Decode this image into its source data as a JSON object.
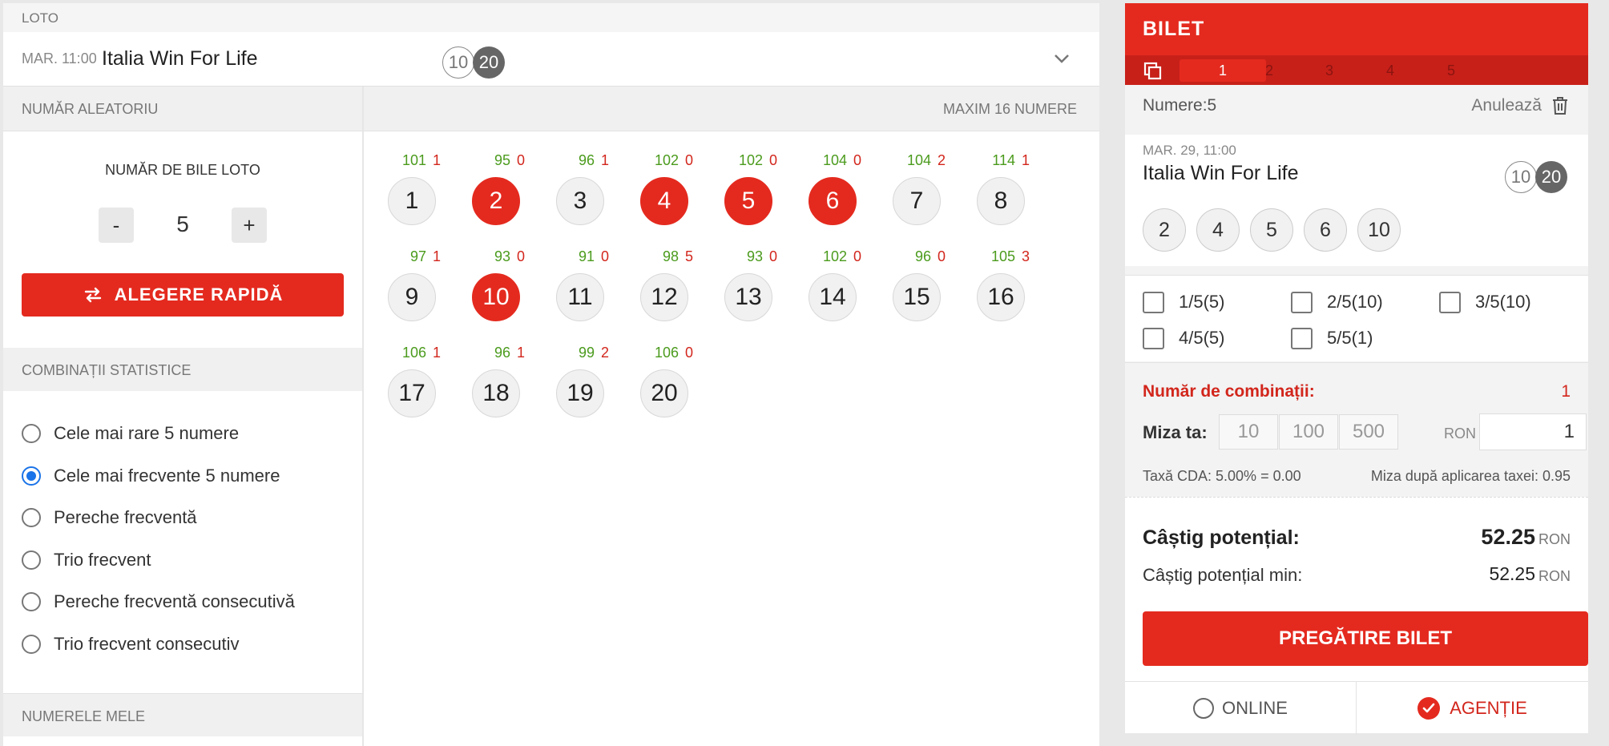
{
  "header": {
    "section_label": "LOTO",
    "event_time": "MAR. 11:00",
    "event_name": "Italia Win For Life",
    "badge_a": "10",
    "badge_b": "20"
  },
  "subbar": {
    "left": "NUMĂR ALEATORIU",
    "right": "MAXIM 16 NUMERE"
  },
  "random": {
    "title": "NUMĂR DE BILE LOTO",
    "minus": "-",
    "plus": "+",
    "value": "5",
    "quick_pick": "ALEGERE RAPIDĂ"
  },
  "combinations": {
    "header": "COMBINAȚII STATISTICE",
    "options": [
      {
        "label": "Cele mai rare 5 numere",
        "checked": false
      },
      {
        "label": "Cele mai frecvente 5 numere",
        "checked": true
      },
      {
        "label": "Pereche frecventă",
        "checked": false
      },
      {
        "label": "Trio frecvent",
        "checked": false
      },
      {
        "label": "Pereche frecventă consecutivă",
        "checked": false
      },
      {
        "label": "Trio frecvent consecutiv",
        "checked": false
      }
    ]
  },
  "my_numbers_header": "NUMERELE MELE",
  "balls": [
    {
      "n": "1",
      "freq": "101",
      "late": "1",
      "selected": false
    },
    {
      "n": "2",
      "freq": "95",
      "late": "0",
      "selected": true
    },
    {
      "n": "3",
      "freq": "96",
      "late": "1",
      "selected": false
    },
    {
      "n": "4",
      "freq": "102",
      "late": "0",
      "selected": true
    },
    {
      "n": "5",
      "freq": "102",
      "late": "0",
      "selected": true
    },
    {
      "n": "6",
      "freq": "104",
      "late": "0",
      "selected": true
    },
    {
      "n": "7",
      "freq": "104",
      "late": "2",
      "selected": false
    },
    {
      "n": "8",
      "freq": "114",
      "late": "1",
      "selected": false
    },
    {
      "n": "9",
      "freq": "97",
      "late": "1",
      "selected": false
    },
    {
      "n": "10",
      "freq": "93",
      "late": "0",
      "selected": true
    },
    {
      "n": "11",
      "freq": "91",
      "late": "0",
      "selected": false
    },
    {
      "n": "12",
      "freq": "98",
      "late": "5",
      "selected": false
    },
    {
      "n": "13",
      "freq": "93",
      "late": "0",
      "selected": false
    },
    {
      "n": "14",
      "freq": "102",
      "late": "0",
      "selected": false
    },
    {
      "n": "15",
      "freq": "96",
      "late": "0",
      "selected": false
    },
    {
      "n": "16",
      "freq": "105",
      "late": "3",
      "selected": false
    },
    {
      "n": "17",
      "freq": "106",
      "late": "1",
      "selected": false
    },
    {
      "n": "18",
      "freq": "96",
      "late": "1",
      "selected": false
    },
    {
      "n": "19",
      "freq": "99",
      "late": "2",
      "selected": false
    },
    {
      "n": "20",
      "freq": "106",
      "late": "0",
      "selected": false
    }
  ],
  "ticket": {
    "title": "BILET",
    "tabs": [
      "1",
      "2",
      "3",
      "4",
      "5"
    ],
    "active_tab": "1",
    "numbers_count": "Numere:5",
    "cancel": "Anulează",
    "event_time": "MAR. 29, 11:00",
    "event_name": "Italia Win For Life",
    "badge_a": "10",
    "badge_b": "20",
    "picked": [
      "2",
      "4",
      "5",
      "6",
      "10"
    ],
    "systems": [
      "1/5(5)",
      "2/5(10)",
      "3/5(10)",
      "4/5(5)",
      "5/5(1)"
    ],
    "comb_label": "Număr de combinații:",
    "comb_value": "1",
    "stake_label": "Miza ta:",
    "quick_amounts": [
      "10",
      "100",
      "500"
    ],
    "currency": "RON",
    "stake_value": "1",
    "tax": "Taxă CDA: 5.00% = 0.00",
    "stake_after_tax": "Miza după aplicarea taxei: 0.95",
    "potential_label": "Câștig potențial:",
    "potential_value": "52.25",
    "potential_min_label": "Câștig potențial min:",
    "potential_min_value": "52.25",
    "prepare_button": "PREGĂTIRE BILET",
    "mode_online": "ONLINE",
    "mode_agency": "AGENȚIE"
  },
  "colors": {
    "accent": "#e42a1f",
    "freq_green": "#4b9b1d",
    "late_red": "#d2261c",
    "radio_blue": "#1a73e8"
  }
}
